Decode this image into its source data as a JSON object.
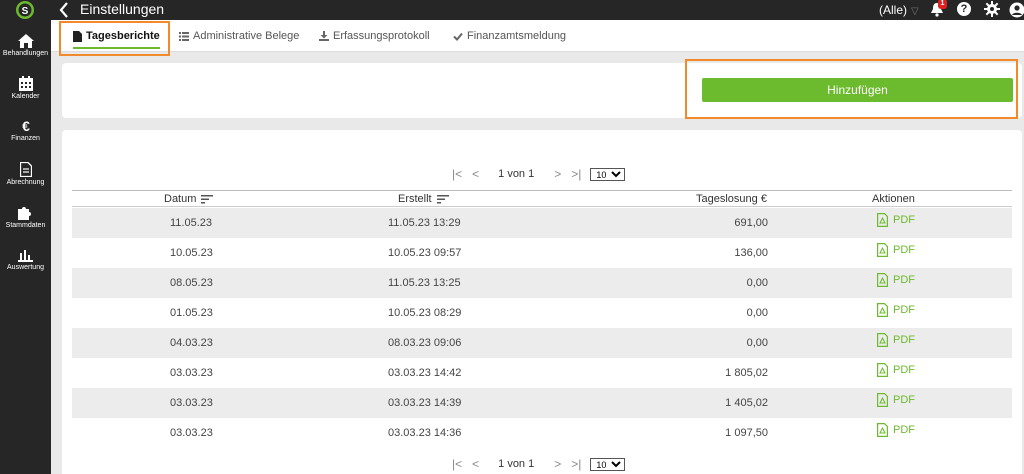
{
  "app": {
    "logo_letter": "S",
    "title": "Einstellungen"
  },
  "sidebar": {
    "items": [
      {
        "label": "Behandlungen",
        "icon": "home-icon"
      },
      {
        "label": "Kalender",
        "icon": "calendar-icon"
      },
      {
        "label": "Finanzen",
        "icon": "euro-icon"
      },
      {
        "label": "Abrechnung",
        "icon": "document-icon"
      },
      {
        "label": "Stammdaten",
        "icon": "puzzle-icon"
      },
      {
        "label": "Auswertung",
        "icon": "bar-chart-icon"
      }
    ]
  },
  "topbar": {
    "filter_label": "(Alle)",
    "notification_count": "1",
    "help_label": "?"
  },
  "tabs": [
    {
      "label": "Tagesberichte",
      "icon": "file-icon",
      "active": true
    },
    {
      "label": "Administrative Belege",
      "icon": "list-icon",
      "active": false
    },
    {
      "label": "Erfassungsprotokoll",
      "icon": "download-icon",
      "active": false
    },
    {
      "label": "Finanzamtsmeldung",
      "icon": "check-icon",
      "active": false
    }
  ],
  "add_button_label": "Hinzufügen",
  "pagination": {
    "info": "1 von 1",
    "page_size": "10",
    "page_size_options": [
      "10"
    ]
  },
  "table": {
    "columns": [
      "Datum",
      "Erstellt",
      "Tageslosung €",
      "Aktionen"
    ],
    "rows": [
      {
        "datum": "11.05.23",
        "erstellt": "11.05.23 13:29",
        "tageslosung": "691,00",
        "action": "PDF"
      },
      {
        "datum": "10.05.23",
        "erstellt": "10.05.23 09:57",
        "tageslosung": "136,00",
        "action": "PDF"
      },
      {
        "datum": "08.05.23",
        "erstellt": "11.05.23 13:25",
        "tageslosung": "0,00",
        "action": "PDF"
      },
      {
        "datum": "01.05.23",
        "erstellt": "10.05.23 08:29",
        "tageslosung": "0,00",
        "action": "PDF"
      },
      {
        "datum": "04.03.23",
        "erstellt": "08.03.23 09:06",
        "tageslosung": "0,00",
        "action": "PDF"
      },
      {
        "datum": "03.03.23",
        "erstellt": "03.03.23 14:42",
        "tageslosung": "1 805,02",
        "action": "PDF"
      },
      {
        "datum": "03.03.23",
        "erstellt": "03.03.23 14:39",
        "tageslosung": "1 405,02",
        "action": "PDF"
      },
      {
        "datum": "03.03.23",
        "erstellt": "03.03.23 14:36",
        "tageslosung": "1 097,50",
        "action": "PDF"
      }
    ]
  },
  "colors": {
    "accent": "#6cba2d",
    "highlight": "#f08a2a",
    "dark": "#262626"
  }
}
